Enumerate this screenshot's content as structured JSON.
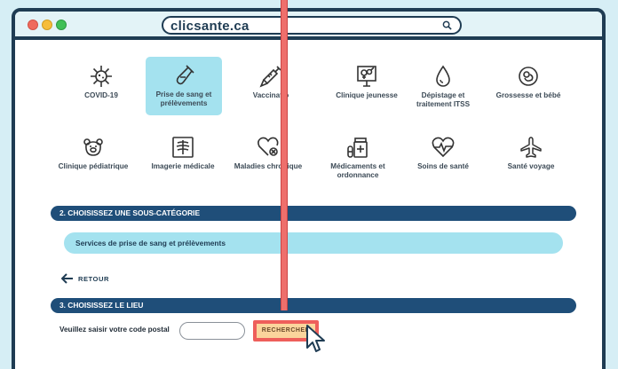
{
  "browser": {
    "url": "clicsante.ca"
  },
  "categories": [
    {
      "label": "COVID-19",
      "icon": "virus-icon"
    },
    {
      "label": "Prise de sang et prélèvements",
      "icon": "test-tube-icon"
    },
    {
      "label": "Vaccinatio",
      "icon": "syringe-icon"
    },
    {
      "label": "Clinique jeunesse",
      "icon": "gender-sign-icon"
    },
    {
      "label": "Dépistage et traitement ITSS",
      "icon": "drop-icon"
    },
    {
      "label": "Grossesse et bébé",
      "icon": "baby-icon"
    },
    {
      "label": "Clinique pédiatrique",
      "icon": "bear-icon"
    },
    {
      "label": "Imagerie médicale",
      "icon": "xray-icon"
    },
    {
      "label": "Maladies chronique",
      "icon": "heart-icon"
    },
    {
      "label": "Médicaments et ordonnance",
      "icon": "medication-icon"
    },
    {
      "label": "Soins de santé",
      "icon": "heartbeat-icon"
    },
    {
      "label": "Santé voyage",
      "icon": "airplane-icon"
    }
  ],
  "section2": {
    "title": "2. CHOISISSEZ UNE SOUS-CATÉGORIE",
    "subcategory": "Services de prise de sang et prélèvements"
  },
  "back": {
    "label": "RETOUR"
  },
  "section3": {
    "title": "3. CHOISISSEZ LE LIEU",
    "postal_label": "Veuillez saisir votre code postal",
    "postal_value": "",
    "search_button": "RECHERCHER"
  },
  "colors": {
    "navy": "#1f4e79",
    "selected": "#a4e2ef",
    "highlight": "#ee5f5b",
    "button": "#fbd59c"
  }
}
